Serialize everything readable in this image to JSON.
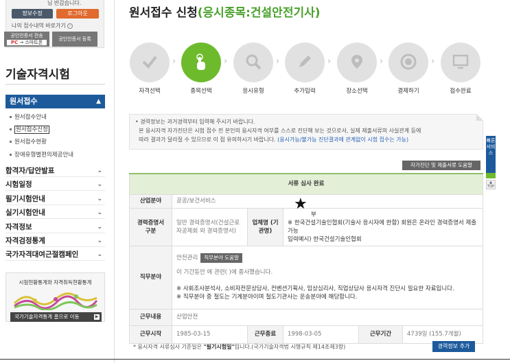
{
  "sidebar": {
    "login_top_text": "님 반갑습니다.",
    "info_button": "정보수정",
    "logout_button": "로그아웃",
    "recent_link": "나의 접수내역 바로가기",
    "cert_transfer": "공인인증서 전송",
    "cert_pc": "PC",
    "cert_smart": "스마트폰",
    "cert_register": "공인인증서 등록",
    "title": "기술자격시험",
    "active_menu": "원서접수",
    "submenu": [
      "원서접수안내",
      "원서접수신청",
      "원서접수현황",
      "장애유형별편의제공안내"
    ],
    "menu": [
      "합격자/답안발표",
      "시험일정",
      "필기시험안내",
      "실기시험안내",
      "자격정보",
      "자격검정통계",
      "국가자격대여근절캠페인"
    ],
    "banner_title": "시험현황통계와 자격취득현황통계",
    "banner_link": "국가기술자격통계 홈으로 이동"
  },
  "main": {
    "title_prefix": "원서접수 신청",
    "title_highlight": "(응시종목:건설안전기사)",
    "steps": [
      {
        "label": "자격선택",
        "icon": "check-icon"
      },
      {
        "label": "종목선택",
        "icon": "hand-pointer-icon"
      },
      {
        "label": "응시유형",
        "icon": "search-icon"
      },
      {
        "label": "추가입력",
        "icon": "pencil-icon"
      },
      {
        "label": "장소선택",
        "icon": "map-pin-icon"
      },
      {
        "label": "결제하기",
        "icon": "won-coin-icon"
      },
      {
        "label": "접수완료",
        "icon": "monitor-ok-icon"
      }
    ],
    "notice_line1": "경력정보는 과거경력부터 입력해 주시기 바랍니다.",
    "notice_line2": "본 응시자격 자가진단은 시험 접수 전 본인의 응시자격 여부를 스스로 진단해 보는 것으로서, 실제 제출서류의 사실관계 등에",
    "notice_line3": "따라 결과가 달라질 수 있으므로 이 점 유의하시기 바랍니다.",
    "notice_link": "(응시가능/불가능 진단결과에 관계없이 시험 접수는 가능)",
    "help_button": "자가진단 및 제출서류 도움말",
    "table": {
      "header": "서류 심사 완료",
      "industry_label": "산업분야",
      "industry_value": "공공/보건서비스",
      "cert_label": "경력증명서 구분",
      "cert_value": "일반 경력증명서(건설근로자공제회 외 경력증명서)",
      "org_label": "업체명 (기관명)",
      "org_line1": "부",
      "org_line2": "※ 한국건설기술인협회(기술사 응시자에 한함) 회원은 온라인 경력증명서 제출가능",
      "org_line3": "입력예시) 한국건설기술인협회",
      "job_label": "직무분야",
      "job_value": "안전관리",
      "job_help": "직무분야 도움말",
      "job_desc": "이 기간동안 에 관련( )에 종사했습니다.",
      "job_note1": "※ 사회조사분석사, 소비자전문상담사, 컨벤션기획사, 임상심리사, 직업상담사 응시자격 진단시 필요한 자료입니다.",
      "job_note2": "※ 직무분야 중 철도는 기계분야이며 철도기관사는 운송분야에 해당합니다.",
      "content_label": "근무내용",
      "content_value": "산업안전",
      "start_label": "근무시작",
      "start_value": "1985-03-15",
      "end_label": "근무종료",
      "end_value": "1998-03-05",
      "period_label": "근무기간",
      "period_value": "4739일 (155.7개월)"
    },
    "footnote_pre": "응시자격 서류심사 기준일은 ",
    "footnote_bold": "\"필기시험일\"",
    "footnote_post": "입니다.(국가기술자격법 시행규칙 제14조제3항)",
    "add_button": "경력정보 추가",
    "star_mark": "★"
  },
  "quick": {
    "label": "빠른서비스",
    "top": "TOP"
  },
  "colors": {
    "green": "#4aa02c",
    "active_step": "#6dbb2c",
    "navy": "#1d5a9c",
    "logout": "#e16a2e"
  }
}
